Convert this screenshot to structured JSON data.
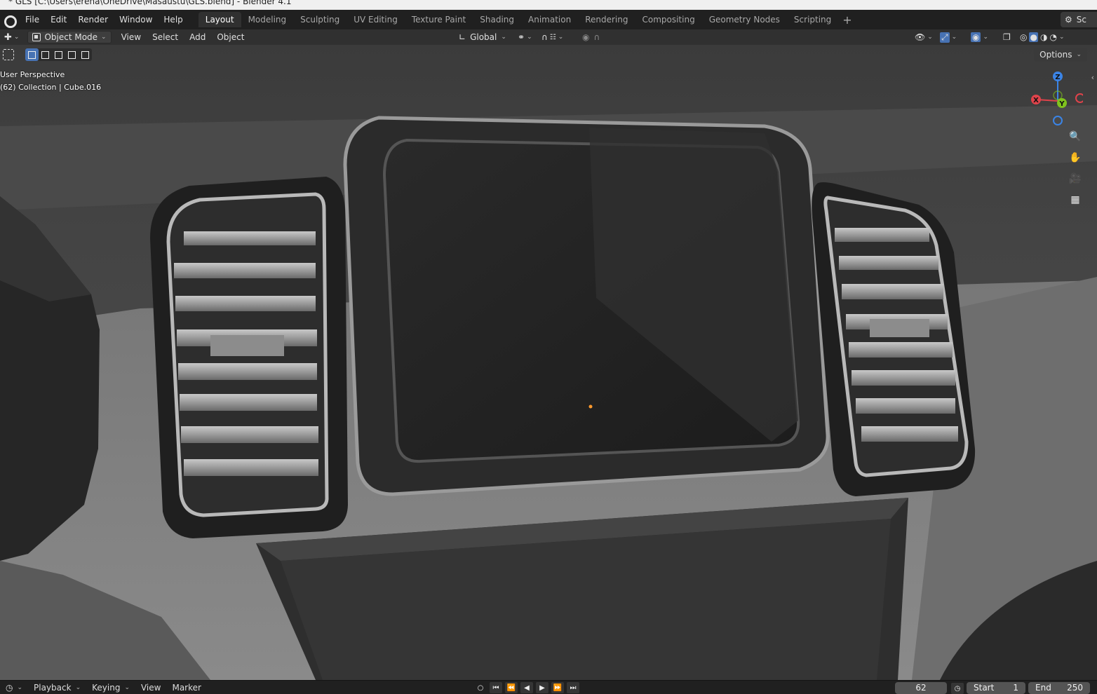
{
  "window": {
    "title": "* GLS [C:\\Users\\erena\\OneDrive\\Masaüstü\\GLS.blend] - Blender 4.1"
  },
  "menu": [
    "File",
    "Edit",
    "Render",
    "Window",
    "Help"
  ],
  "workspaces": [
    "Layout",
    "Modeling",
    "Sculpting",
    "UV Editing",
    "Texture Paint",
    "Shading",
    "Animation",
    "Rendering",
    "Compositing",
    "Geometry Nodes",
    "Scripting"
  ],
  "active_workspace": "Layout",
  "scene_label": "Sc",
  "viewport_header": {
    "mode": "Object Mode",
    "menus": [
      "View",
      "Select",
      "Add",
      "Object"
    ],
    "orientation": "Global"
  },
  "viewport": {
    "perspective_label": "User Perspective",
    "collection_label": "(62) Collection | Cube.016",
    "options_label": "Options",
    "gizmo_axes": {
      "z": "Z",
      "x": "X",
      "y": "Y"
    }
  },
  "timeline": {
    "menus": [
      "Playback",
      "Keying",
      "View",
      "Marker"
    ],
    "current_frame": "62",
    "start_label": "Start",
    "start_value": "1",
    "end_label": "End",
    "end_value": "250"
  },
  "colors": {
    "active_select": "#4772b3",
    "axis_x": "#e0434b",
    "axis_y": "#7fc31d",
    "axis_z": "#3b84e6",
    "origin_dot": "#ff9a2e"
  }
}
